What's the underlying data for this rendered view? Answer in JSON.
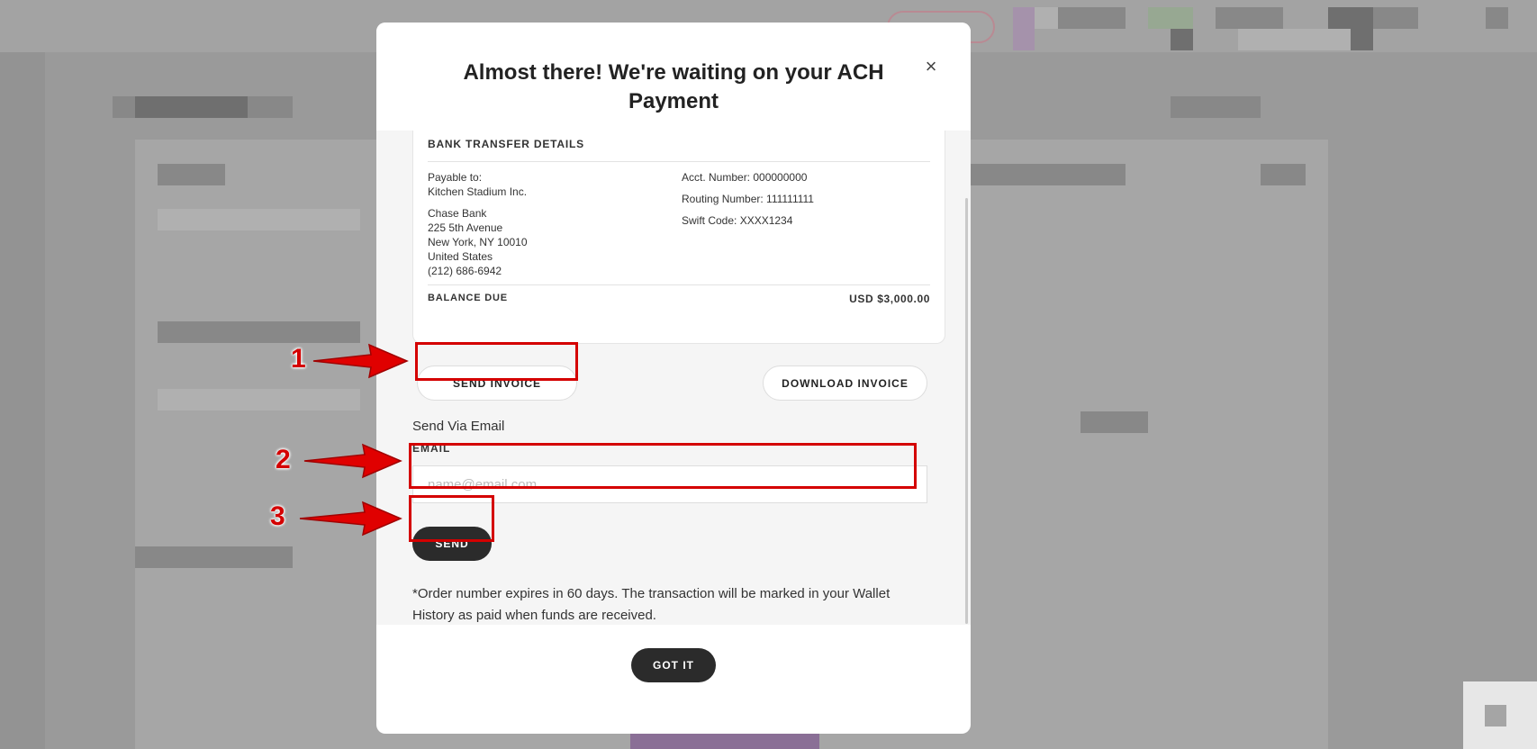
{
  "modal": {
    "title": "Almost there! We're waiting on your ACH Payment",
    "close_icon": "close-icon"
  },
  "bank": {
    "heading": "BANK TRANSFER DETAILS",
    "payable_label": "Payable to:",
    "payable_name": "Kitchen Stadium Inc.",
    "bank_name": "Chase Bank",
    "address_line1": "225 5th Avenue",
    "address_line2": "New York, NY 10010",
    "country": "United States",
    "phone": "(212) 686-6942",
    "acct_number": "Acct. Number: 000000000",
    "routing_number": "Routing Number: 111111111",
    "swift_code": "Swift Code: XXXX1234",
    "balance_label": "BALANCE DUE",
    "balance_value": "USD $3,000.00"
  },
  "actions": {
    "send_invoice": "SEND INVOICE",
    "download_invoice": "DOWNLOAD INVOICE"
  },
  "email_form": {
    "heading": "Send Via Email",
    "label": "EMAIL",
    "placeholder": "name@email.com",
    "value": "",
    "send_button": "SEND"
  },
  "note": "*Order number expires in 60 days. The transaction will be marked in your Wallet History as paid when funds are received.",
  "footer": {
    "got_it": "GOT IT"
  },
  "annotations": {
    "step1": "1",
    "step2": "2",
    "step3": "3",
    "color": "#d40000"
  }
}
